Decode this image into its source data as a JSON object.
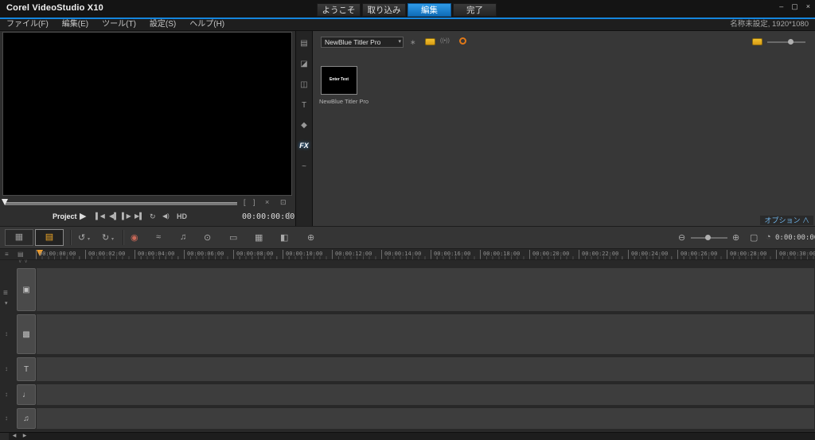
{
  "titlebar": {
    "app_title": "Corel VideoStudio X10",
    "tabs": [
      {
        "label": "ようこそ"
      },
      {
        "label": "取り込み"
      },
      {
        "label": "編集"
      },
      {
        "label": "完了"
      }
    ],
    "active_tab": "編集"
  },
  "menubar": {
    "items": [
      "ファイル(F)",
      "編集(E)",
      "ツール(T)",
      "設定(S)",
      "ヘルプ(H)"
    ],
    "project_info": "名称未設定, 1920*1080"
  },
  "preview": {
    "mode_label": "Project",
    "hd_label": "HD",
    "timecode": "00:00:00:00"
  },
  "library": {
    "category_dropdown": "NewBlue Titler Pro",
    "thumbnail_text": "Enter Text",
    "thumbnail_caption": "NewBlue Titler Pro",
    "options_label": "オプション"
  },
  "timeline": {
    "timecode": "0:00:00:00",
    "ruler": [
      "00:00:00:00",
      "00:00:02:00",
      "00:00:04:00",
      "00:00:06:00",
      "00:00:08:00",
      "00:00:10:00",
      "00:00:12:00",
      "00:00:14:00",
      "00:00:16:00",
      "00:00:18:00",
      "00:00:20:00",
      "00:00:22:00",
      "00:00:24:00",
      "00:00:26:00",
      "00:00:28:00",
      "00:00:30:00"
    ],
    "tracks": [
      {
        "name": "video",
        "icon": "▣",
        "icon_name": "video-track-icon",
        "height": 54
      },
      {
        "name": "overlay",
        "icon": "▩",
        "icon_name": "overlay-track-icon",
        "height": 50
      },
      {
        "name": "title",
        "icon": "T",
        "icon_name": "title-track-icon",
        "height": 30
      },
      {
        "name": "voice",
        "icon": "♩",
        "icon_name": "voice-track-icon",
        "height": 26
      },
      {
        "name": "music",
        "icon": "♫",
        "icon_name": "music-track-icon",
        "height": 26
      }
    ]
  },
  "icons": {
    "minimize": "–",
    "restore": "▢",
    "close": "×",
    "play": "▶",
    "go_start": "▌◀",
    "prev_frame": "◀▌",
    "next_frame": "▌▶",
    "go_end": "▶▌",
    "repeat": "↻",
    "volume": "◀)",
    "mark_in": "[",
    "mark_out": "]",
    "delete_clip": "×",
    "enlarge": "⊡",
    "spin_up": "▲",
    "spin_down": "▼",
    "dropdown_caret": "▾",
    "nav_media": "▤",
    "nav_instant_project": "◪",
    "nav_transition": "◫",
    "nav_title": "T",
    "nav_graphic": "◆",
    "nav_filter": "FX",
    "nav_motion_path": "~",
    "lib_filter": "∗",
    "lib_broadcast": "((•))",
    "storyboard_view": "▦",
    "timeline_view": "▤",
    "undo": "↺",
    "redo": "↻",
    "record_options": "◉",
    "sound_mixer": "≈",
    "auto_music": "♫",
    "motion_tracking": "⊙",
    "subtitle_editor": "▭",
    "multicam_editor": "▦",
    "mask_creator": "◧",
    "web_tool": "⊕",
    "zoom_out": "⊖",
    "zoom_in": "⊕",
    "fit_project": "▢",
    "clock": "◔",
    "ruler_corner_a": "≡",
    "ruler_corner_b": "▤",
    "gutter_menu": "≡",
    "gutter_caret": "▾",
    "chevrons": "∨∨",
    "options_collapse": "∧",
    "scroll_left": "◀",
    "scroll_right": "▶"
  }
}
